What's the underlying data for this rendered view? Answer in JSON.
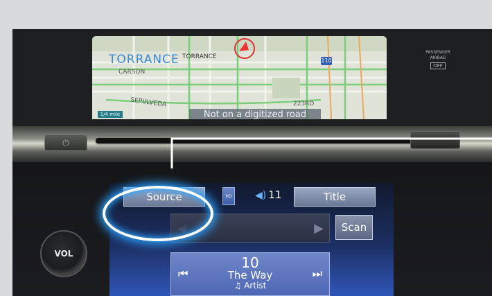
{
  "map": {
    "town": "TORRANCE",
    "town_small": "TORRANCE",
    "carson": "CARSON",
    "sepulveda": "SEPULVEDA",
    "street_223": "223RD",
    "highway": "110",
    "status": "Not on a digitized road",
    "scale": "1/4 mile"
  },
  "airbag": {
    "line1": "PASSENGER",
    "line2": "AIRBAG",
    "state": "OFF"
  },
  "audio": {
    "source_label": "Source",
    "hd_label": "HD",
    "volume": "11",
    "title_label": "Title",
    "scan_label": "Scan",
    "preset": "10",
    "song": "The Way",
    "artist": "Artist"
  },
  "knob": {
    "label": "VOL"
  },
  "colors": {
    "accent_glow": "#2aa3ff",
    "map_town": "#3a8bd2",
    "button": "#7f8cab"
  }
}
